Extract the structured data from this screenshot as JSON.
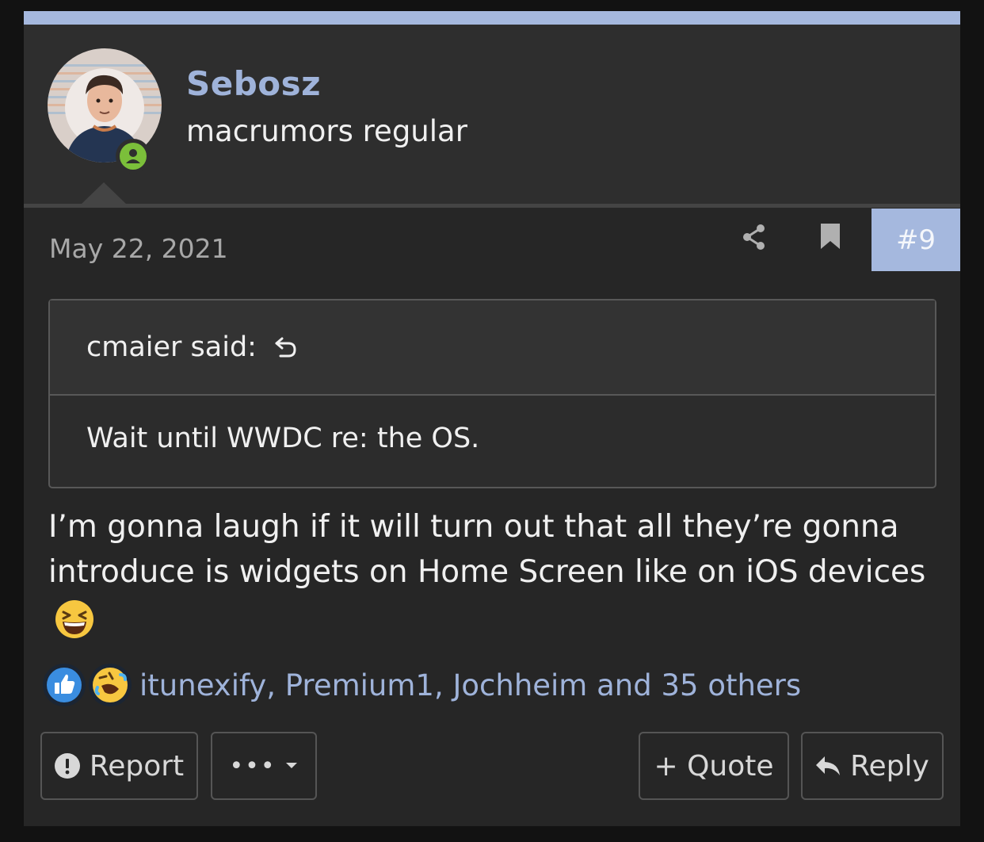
{
  "user": {
    "name": "Sebosz",
    "title": "macrumors regular",
    "status_icon": "online-user-icon"
  },
  "post": {
    "date": "May 22, 2021",
    "number": "#9",
    "share_icon": "share-icon",
    "bookmark_icon": "bookmark-icon"
  },
  "quote": {
    "author": "cmaier said:",
    "text": "Wait until WWDC re: the OS."
  },
  "message": {
    "text": "I’m gonna laugh if it will turn out that all they’re gonna introduce is widgets on Home Screen like on iOS devices",
    "emoji": "laughing-emoji"
  },
  "reactions": {
    "icons": [
      "like-icon",
      "rofl-icon"
    ],
    "summary": "itunexify, Premium1, Jochheim and 35 others"
  },
  "actions": {
    "report": "Report",
    "more": "•••",
    "quote": "+ Quote",
    "reply": "Reply"
  },
  "colors": {
    "accent": "#a5b8de",
    "link": "#9fb3da",
    "online": "#7bbf3a",
    "background": "#262626"
  }
}
